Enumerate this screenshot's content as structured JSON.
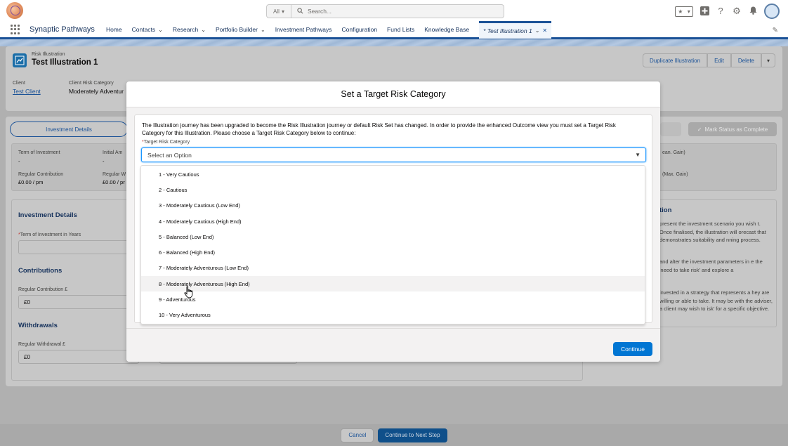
{
  "global_header": {
    "search_scope": "All",
    "search_placeholder": "Search..."
  },
  "nav": {
    "app_name": "Synaptic Pathways",
    "items": [
      {
        "label": "Home",
        "has_menu": false
      },
      {
        "label": "Contacts",
        "has_menu": true
      },
      {
        "label": "Research",
        "has_menu": true
      },
      {
        "label": "Portfolio Builder",
        "has_menu": true
      },
      {
        "label": "Investment Pathways",
        "has_menu": false
      },
      {
        "label": "Configuration",
        "has_menu": false
      },
      {
        "label": "Fund Lists",
        "has_menu": false
      },
      {
        "label": "Knowledge Base",
        "has_menu": false
      }
    ],
    "active_tab": "* Test Illustration 1"
  },
  "record": {
    "type": "Risk Illustration",
    "title": "Test Illustration 1",
    "actions": [
      "Duplicate Illustration",
      "Edit",
      "Delete"
    ],
    "fields": [
      {
        "label": "Client",
        "value": "Test Client"
      },
      {
        "label": "Client Risk Category",
        "value": "Moderately Adventur"
      }
    ]
  },
  "path": {
    "current_step": "Investment Details",
    "mark_complete": "Mark Status as Complete"
  },
  "summary": {
    "term_label": "Term of Investment",
    "term_value": "-",
    "initial_label": "Initial Am",
    "initial_value": "-",
    "regular_contribution_label": "Regular Contribution",
    "regular_contribution_value": "£0.00 / pm",
    "regular_w_label": "Regular W",
    "regular_w_value": "£0.00 / pr",
    "right_1": "ean. Gain)",
    "right_2": "(Max. Gain)"
  },
  "details": {
    "investment_title": "Investment Details",
    "term_years_label": "Term of Investment in Years",
    "contributions_title": "Contributions",
    "regular_contribution_label": "Regular Contribution £",
    "regular_contribution_value": "£0",
    "withdrawals_title": "Withdrawals",
    "regular_withdrawal_label": "Regular Withdrawal £",
    "regular_withdrawal_value": "£0"
  },
  "guidance": {
    "title": "tion",
    "p1": "present the investment scenario you wish t. Once finalised, the illustration will orecast that demonstrates suitability and nning process.",
    "p2": "and alter the investment parameters in e the 'need to take risk' and explore a",
    "p3": "invested in a strategy that represents a hey are willing or able to take. It may be with the adviser, a client may wish to isk' for a specific objective."
  },
  "footer": {
    "cancel": "Cancel",
    "next": "Continue to Next Step"
  },
  "modal": {
    "title": "Set a Target Risk Category",
    "intro": "The Illustration journey has been upgraded to become the Risk Illustration journey or default Risk Set has changed. In order to provide the enhanced Outcome view you must set a Target Risk Category for this Illustration. Please choose a Target Risk Category below to continue:",
    "field_label": "Target Risk Category",
    "placeholder": "Select an Option",
    "options": [
      "1 - Very Cautious",
      "2 - Cautious",
      "3 - Moderately Cautious (Low End)",
      "4 - Moderately Cautious (High End)",
      "5 - Balanced (Low End)",
      "6 - Balanced (High End)",
      "7 - Moderately Adventurous (Low End)",
      "8 - Moderately Adventurous (High End)",
      "9 - Adventurous",
      "10 - Very Adventurous"
    ],
    "hovered_option": "8 - Moderately Adventurous (High End)",
    "continue": "Continue"
  },
  "colors": {
    "brand": "#1b5297",
    "primary_button": "#0176d3",
    "focus_ring": "#1b96ff"
  }
}
